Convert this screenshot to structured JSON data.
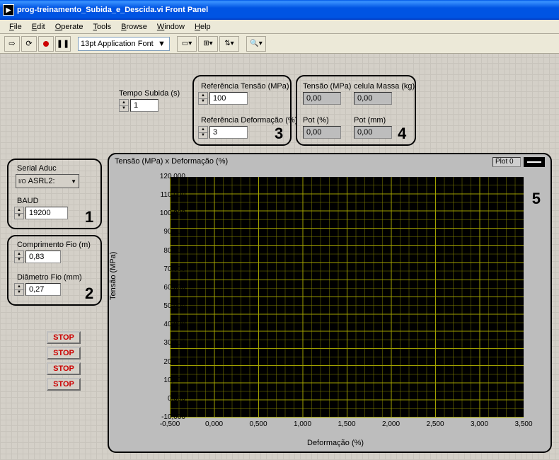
{
  "window": {
    "title": "prog-treinamento_Subida_e_Descida.vi Front Panel"
  },
  "menu": {
    "file": "File",
    "edit": "Edit",
    "operate": "Operate",
    "tools": "Tools",
    "browse": "Browse",
    "window": "Window",
    "help": "Help"
  },
  "toolbar": {
    "font": "13pt Application Font"
  },
  "tempo": {
    "label": "Tempo Subida (s)",
    "value": "1"
  },
  "ref": {
    "tensao": {
      "label": "Referência Tensão (MPa)",
      "value": "100"
    },
    "deform": {
      "label": "Referência Deformação (%)",
      "value": "3"
    }
  },
  "ind": {
    "tensao": {
      "label": "Tensão (MPa)",
      "value": "0,00"
    },
    "massa": {
      "label": "celula Massa (kg)",
      "value": "0,00"
    },
    "potpct": {
      "label": "Pot (%)",
      "value": "0,00"
    },
    "potmm": {
      "label": "Pot (mm)",
      "value": "0,00"
    }
  },
  "serial": {
    "label": "Serial Aduc",
    "port": "ASRL2:",
    "baud_label": "BAUD",
    "baud": "19200"
  },
  "fio": {
    "comp": {
      "label": "Comprimento Fio (m)",
      "value": "0,83"
    },
    "diam": {
      "label": "Diâmetro Fio (mm)",
      "value": "0,27"
    }
  },
  "stop": "STOP",
  "chart_data": {
    "type": "line",
    "title": "Tensão (MPa) x Deformação (%)",
    "legend": "Plot 0",
    "xlabel": "Deformação (%)",
    "ylabel": "Tensão (MPa)",
    "xlim": [
      -0.5,
      3.5
    ],
    "ylim": [
      -10,
      120
    ],
    "xticks": [
      "-0,500",
      "0,000",
      "0,500",
      "1,000",
      "1,500",
      "2,000",
      "2,500",
      "3,000",
      "3,500"
    ],
    "yticks": [
      "120,000",
      "110,000",
      "100,000",
      "90,000",
      "80,000",
      "70,000",
      "60,000",
      "50,000",
      "40,000",
      "30,000",
      "20,000",
      "10,000",
      "0,000",
      "-10,000"
    ],
    "series": [
      {
        "name": "Plot 0",
        "x": [],
        "y": []
      }
    ]
  },
  "annot": {
    "1": "1",
    "2": "2",
    "3": "3",
    "4": "4",
    "5": "5"
  }
}
